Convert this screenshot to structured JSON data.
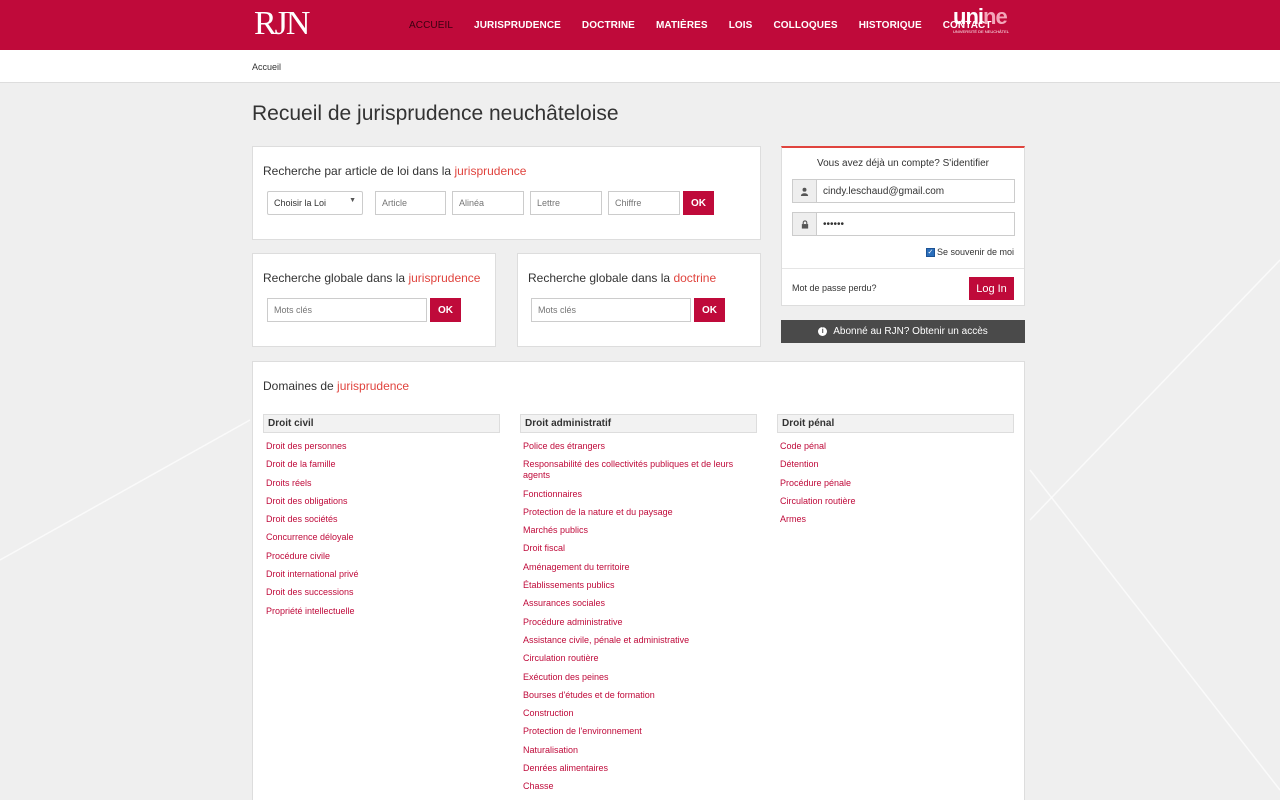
{
  "header": {
    "logo": "RJN",
    "nav": [
      {
        "label": "ACCUEIL",
        "active": true
      },
      {
        "label": "JURISPRUDENCE",
        "active": false
      },
      {
        "label": "DOCTRINE",
        "active": false
      },
      {
        "label": "MATIÈRES",
        "active": false
      },
      {
        "label": "LOIS",
        "active": false
      },
      {
        "label": "COLLOQUES",
        "active": false
      },
      {
        "label": "HISTORIQUE",
        "active": false
      },
      {
        "label": "CONTACT",
        "active": false
      }
    ],
    "unine_logo_text": "unine",
    "unine_subtext": "Université de Neuchâtel"
  },
  "breadcrumb": "Accueil",
  "page_title": "Recueil de jurisprudence neuchâteloise",
  "search_article": {
    "title_prefix": "Recherche par article de loi dans la ",
    "title_highlight": "jurisprudence",
    "law_select": "Choisir la Loi",
    "article_placeholder": "Article",
    "alinea_placeholder": "Alinéa",
    "lettre_placeholder": "Lettre",
    "chiffre_placeholder": "Chiffre",
    "ok_label": "OK"
  },
  "search_global_juris": {
    "title_prefix": "Recherche globale dans la ",
    "title_highlight": "jurisprudence",
    "placeholder": "Mots clés",
    "ok_label": "OK"
  },
  "search_global_doctrine": {
    "title_prefix": "Recherche globale dans la ",
    "title_highlight": "doctrine",
    "placeholder": "Mots clés",
    "ok_label": "OK"
  },
  "login": {
    "heading": "Vous avez déjà un compte? S'identifier",
    "email_value": "cindy.leschaud@gmail.com",
    "password_value": "••••••",
    "remember_label": "Se souvenir de moi",
    "remember_checked": true,
    "lost_password": "Mot de passe perdu?",
    "login_button": "Log In"
  },
  "subscribe_button": "Abonné au RJN? Obtenir un accès",
  "domains": {
    "title_prefix": "Domaines de ",
    "title_highlight": "jurisprudence",
    "columns": [
      {
        "heading": "Droit civil",
        "items": [
          "Droit des personnes",
          "Droit de la famille",
          "Droits réels",
          "Droit des obligations",
          "Droit des sociétés",
          "Concurrence déloyale",
          "Procédure civile",
          "Droit international privé",
          "Droit des successions",
          "Propriété intellectuelle"
        ]
      },
      {
        "heading": "Droit administratif",
        "items": [
          "Police des étrangers",
          "Responsabilité des collectivités publiques et de leurs agents",
          "Fonctionnaires",
          "Protection de la nature et du paysage",
          "Marchés publics",
          "Droit fiscal",
          "Aménagement du territoire",
          "Établissements publics",
          "Assurances sociales",
          "Procédure administrative",
          "Assistance civile, pénale et administrative",
          "Circulation routière",
          "Exécution des peines",
          "Bourses d'études et de formation",
          "Construction",
          "Protection de l'environnement",
          "Naturalisation",
          "Denrées alimentaires",
          "Chasse"
        ]
      },
      {
        "heading": "Droit pénal",
        "items": [
          "Code pénal",
          "Détention",
          "Procédure pénale",
          "Circulation routière",
          "Armes"
        ]
      }
    ]
  },
  "colors": {
    "brand": "#bf0a3a",
    "highlight": "#e0443e",
    "dark_button": "#4a4a4a"
  }
}
